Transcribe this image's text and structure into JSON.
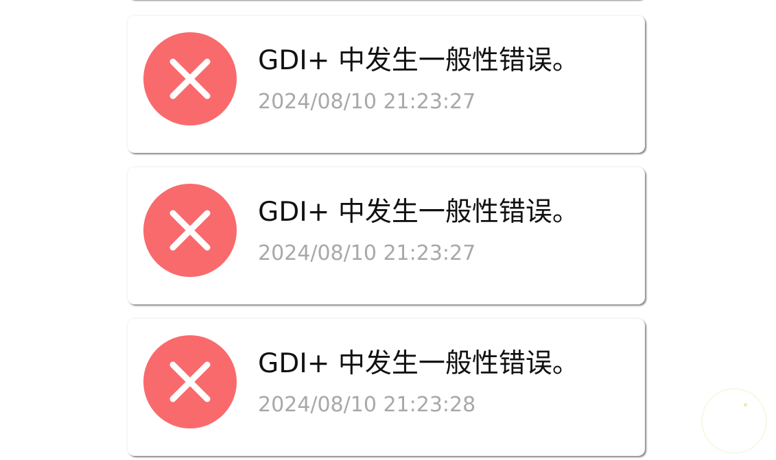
{
  "colors": {
    "error_red": "#f96a6d",
    "message_text": "#111111",
    "timestamp_text": "#a8a8a8",
    "card_background": "#ffffff"
  },
  "notifications": [
    {
      "icon": "error-x-icon",
      "message": "GDI+ 中发生一般性错误。",
      "timestamp": "2024/08/10 21:23:27"
    },
    {
      "icon": "error-x-icon",
      "message": "GDI+ 中发生一般性错误。",
      "timestamp": "2024/08/10 21:23:27"
    },
    {
      "icon": "error-x-icon",
      "message": "GDI+ 中发生一般性错误。",
      "timestamp": "2024/08/10 21:23:28"
    }
  ]
}
